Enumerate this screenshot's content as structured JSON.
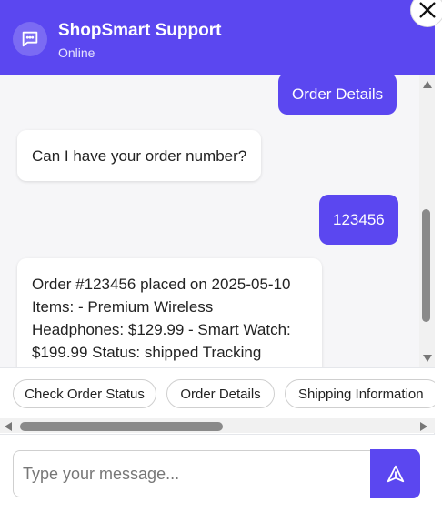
{
  "colors": {
    "accent": "#5b47f0"
  },
  "header": {
    "title": "ShopSmart Support",
    "status": "Online",
    "avatar_icon": "chat-bubble-icon",
    "close_icon": "close-icon"
  },
  "messages": [
    {
      "sender": "user",
      "text": "Order Details"
    },
    {
      "sender": "bot",
      "text": "Can I have your order number?"
    },
    {
      "sender": "user",
      "text": "123456"
    },
    {
      "sender": "bot",
      "lines": [
        "Order #123456 placed on 2025-05-10",
        "Items: - Premium Wireless",
        "Headphones: $129.99 - Smart Watch:",
        "$199.99 Status: shipped Tracking"
      ]
    }
  ],
  "quick_replies": [
    "Check Order Status",
    "Order Details",
    "Shipping Information"
  ],
  "composer": {
    "placeholder": "Type your message...",
    "send_icon": "send-icon"
  }
}
